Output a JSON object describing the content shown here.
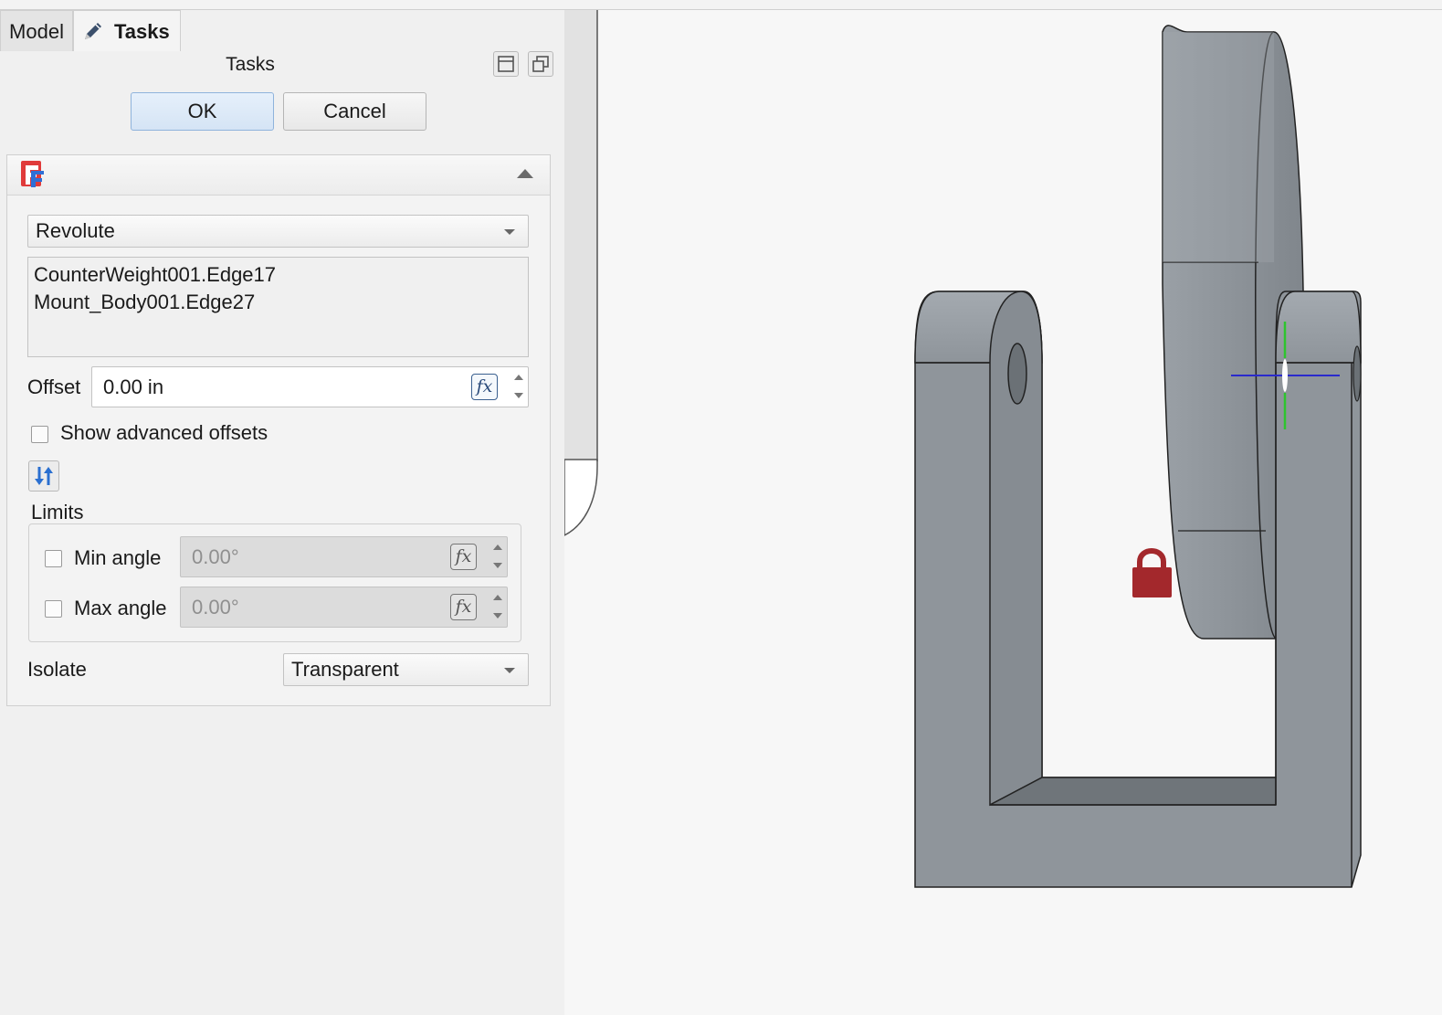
{
  "tabs": [
    {
      "label": "Model"
    },
    {
      "label": "Tasks",
      "icon": "pencil-icon"
    }
  ],
  "tasks": {
    "title": "Tasks",
    "ok_label": "OK",
    "cancel_label": "Cancel"
  },
  "joint": {
    "type_value": "Revolute",
    "references": [
      "CounterWeight001.Edge17",
      "Mount_Body001.Edge27"
    ],
    "offset_label": "Offset",
    "offset_value": "0.00 in",
    "show_advanced_label": "Show advanced offsets",
    "limits_title": "Limits",
    "min_angle_label": "Min angle",
    "min_angle_value": "0.00°",
    "max_angle_label": "Max angle",
    "max_angle_value": "0.00°",
    "isolate_label": "Isolate",
    "isolate_value": "Transparent",
    "fx_label": "fx"
  },
  "colors": {
    "accent": "#8fb3dc",
    "lock": "#a3282c",
    "model_gray": "#8e949a"
  }
}
